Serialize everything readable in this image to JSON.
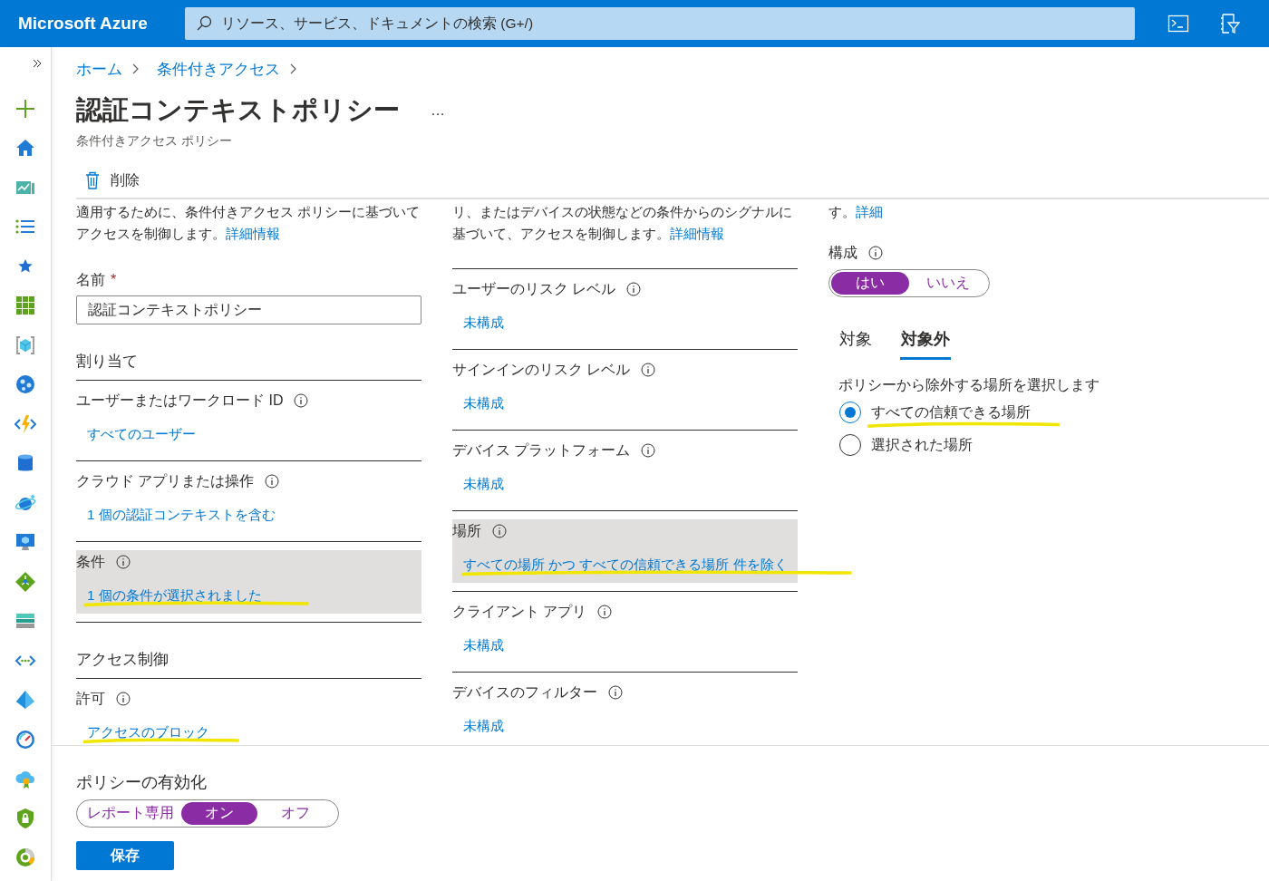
{
  "topbar": {
    "brand": "Microsoft Azure",
    "search": {
      "placeholder": "リソース、サービス、ドキュメントの検索 (G+/)"
    }
  },
  "breadcrumb": [
    "ホーム",
    "条件付きアクセス"
  ],
  "title": "認証コンテキストポリシー",
  "more": "…",
  "subtitle": "条件付きアクセス ポリシー",
  "toolbar": [
    {
      "label": "削除"
    }
  ],
  "column_1": {
    "intro": {
      "text": "適用するために、条件付きアクセス ポリシーに基づいてアクセスを制御します。",
      "link": "詳細情報"
    },
    "name_field": {
      "label": "名前",
      "required": "*",
      "value": "認証コンテキストポリシー"
    },
    "assignments": {
      "heading": "割り当て",
      "items": [
        {
          "label": "ユーザーまたはワークロード ID",
          "value": "すべてのユーザー",
          "selected": false,
          "highlighted": false
        },
        {
          "label": "クラウド アプリまたは操作",
          "value": "1 個の認証コンテキストを含む",
          "selected": false,
          "highlighted": false
        },
        {
          "label": "条件",
          "value": "1 個の条件が選択されました",
          "selected": true,
          "highlighted": true
        }
      ]
    },
    "access_controls": {
      "heading": "アクセス制御",
      "items": [
        {
          "label": "許可",
          "value": "アクセスのブロック",
          "selected": false,
          "highlighted": true
        }
      ]
    }
  },
  "column_2": {
    "intro": {
      "text": "リ、またはデバイスの状態などの条件からのシグナルに基づいて、アクセスを制御します。",
      "link": "詳細情報"
    },
    "items": [
      {
        "label": "ユーザーのリスク レベル",
        "value": "未構成",
        "selected": false,
        "highlighted": false
      },
      {
        "label": "サインインのリスク レベル",
        "value": "未構成",
        "selected": false,
        "highlighted": false
      },
      {
        "label": "デバイス プラットフォーム",
        "value": "未構成",
        "selected": false,
        "highlighted": false
      },
      {
        "label": "場所",
        "value": "すべての場所 かつ すべての信頼できる場所 件を除く",
        "selected": true,
        "highlighted": true
      },
      {
        "label": "クライアント アプリ",
        "value": "未構成",
        "selected": false,
        "highlighted": false
      },
      {
        "label": "デバイスのフィルター",
        "value": "未構成",
        "selected": false,
        "highlighted": false
      }
    ]
  },
  "column_3": {
    "intro": {
      "text": "す。",
      "link": "詳細"
    },
    "configure": {
      "label": "構成",
      "options": [
        {
          "label": "はい",
          "selected": true
        },
        {
          "label": "いいえ",
          "selected": false
        }
      ]
    },
    "tabs": [
      {
        "label": "対象",
        "selected": false
      },
      {
        "label": "対象外",
        "selected": true
      }
    ],
    "instruction": "ポリシーから除外する場所を選択します",
    "radios": [
      {
        "label": "すべての信頼できる場所",
        "selected": true,
        "highlighted": true
      },
      {
        "label": "選択された場所",
        "selected": false,
        "highlighted": false
      }
    ]
  },
  "footer": {
    "label": "ポリシーの有効化",
    "options": [
      {
        "label": "レポート専用",
        "selected": false
      },
      {
        "label": "オン",
        "selected": true
      },
      {
        "label": "オフ",
        "selected": false
      }
    ],
    "save": "保存"
  }
}
